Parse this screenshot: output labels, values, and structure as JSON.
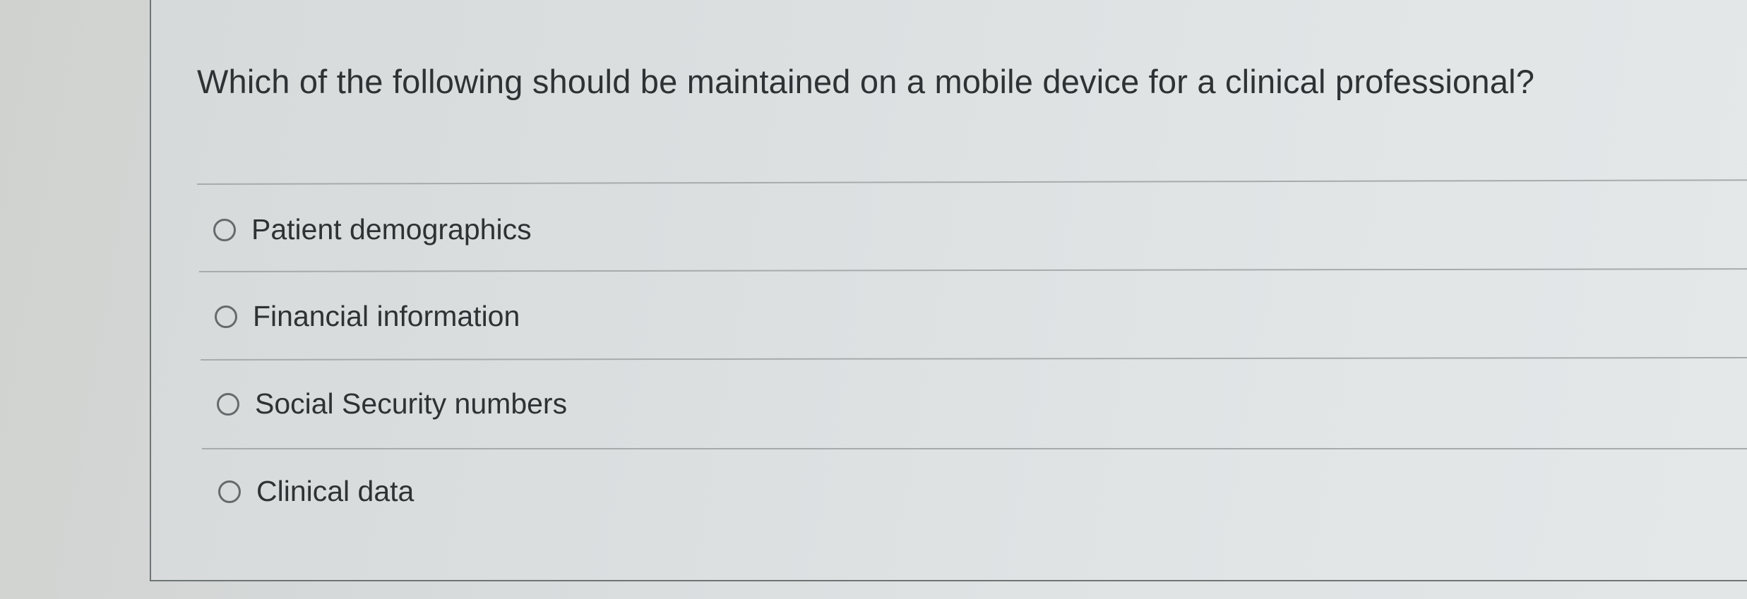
{
  "question": {
    "text": "Which of the following should be maintained on a mobile device for a clinical professional?"
  },
  "options": [
    {
      "label": "Patient demographics",
      "selected": false
    },
    {
      "label": "Financial information",
      "selected": false
    },
    {
      "label": "Social Security numbers",
      "selected": false
    },
    {
      "label": "Clinical data",
      "selected": false
    }
  ]
}
